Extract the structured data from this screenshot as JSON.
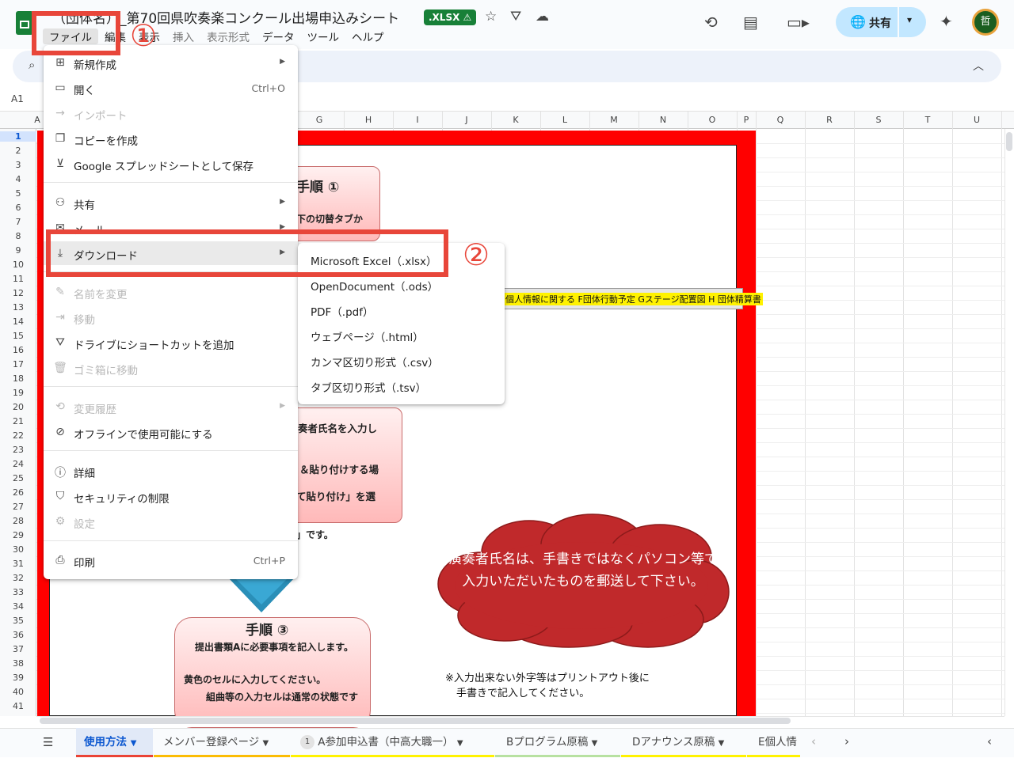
{
  "header": {
    "title": "（団体名）_第70回県吹奏楽コンクール出場申込みシート",
    "file_badge": ".XLSX ⚠",
    "share_label": "共有",
    "avatar_initial": "哲",
    "menus": [
      "ファイル",
      "編集",
      "表示",
      "挿入",
      "表示形式",
      "データ",
      "ツール",
      "ヘルプ"
    ]
  },
  "formula_bar": {
    "cell_ref": "A1"
  },
  "columns": [
    "A",
    "G",
    "H",
    "I",
    "J",
    "K",
    "L",
    "M",
    "N",
    "O",
    "P",
    "Q",
    "R",
    "S",
    "T",
    "U"
  ],
  "rows": [
    "1",
    "2",
    "3",
    "4",
    "5",
    "6",
    "7",
    "8",
    "9",
    "10",
    "11",
    "12",
    "13",
    "14",
    "15",
    "16",
    "17",
    "18",
    "19",
    "20",
    "21",
    "22",
    "23",
    "24",
    "25",
    "26",
    "27",
    "28",
    "29",
    "30",
    "31",
    "32",
    "33",
    "34",
    "35",
    "36",
    "37",
    "38",
    "39",
    "40",
    "41"
  ],
  "file_menu": {
    "items": [
      {
        "icon": "new-icon",
        "label": "新規作成",
        "submenu": true
      },
      {
        "icon": "folder-icon",
        "label": "開く",
        "shortcut": "Ctrl+O"
      },
      {
        "icon": "import-icon",
        "label": "インポート",
        "disabled": true
      },
      {
        "icon": "copy-icon",
        "label": "コピーを作成"
      },
      {
        "icon": "save-icon",
        "label": "Google スプレッドシートとして保存"
      },
      {
        "icon": "share-icon",
        "label": "共有",
        "submenu": true
      },
      {
        "icon": "mail-icon",
        "label": "メール",
        "submenu": true
      },
      {
        "icon": "download-icon",
        "label": "ダウンロード",
        "submenu": true
      },
      {
        "icon": "rename-icon",
        "label": "名前を変更",
        "disabled": true
      },
      {
        "icon": "move-icon",
        "label": "移動",
        "disabled": true
      },
      {
        "icon": "drive-shortcut-icon",
        "label": "ドライブにショートカットを追加"
      },
      {
        "icon": "trash-icon",
        "label": "ゴミ箱に移動",
        "disabled": true
      },
      {
        "icon": "history-icon",
        "label": "変更履歴",
        "submenu": true,
        "disabled": true
      },
      {
        "icon": "offline-icon",
        "label": "オフラインで使用可能にする"
      },
      {
        "icon": "info-icon",
        "label": "詳細"
      },
      {
        "icon": "security-icon",
        "label": "セキュリティの制限"
      },
      {
        "icon": "settings-icon",
        "label": "設定",
        "disabled": true
      },
      {
        "icon": "print-icon",
        "label": "印刷",
        "shortcut": "Ctrl+P"
      }
    ]
  },
  "download_submenu": {
    "items": [
      "Microsoft Excel（.xlsx）",
      "OpenDocument（.ods）",
      "PDF（.pdf）",
      "ウェブページ（.html）",
      "カンマ区切り形式（.csv）",
      "タブ区切り形式（.tsv）"
    ]
  },
  "annotations": {
    "step1": "①",
    "step2": "②"
  },
  "sheet_content": {
    "card1_title": "手順 ①",
    "card1_text": "下の切替タブか",
    "card2_line1": "奏者氏名を入力し",
    "card2_line2": "＆貼り付けする場",
    "card2_line3": "て貼り付け」を選",
    "card2_tail": "」です。",
    "card3_title": "手順 ③",
    "card3_line1": "提出書類Aに必要事項を記入します。",
    "card3_line2": "黄色のセルに入力してください。",
    "card3_line3": "組曲等の入力セルは通常の状態です",
    "cloud_text": "演奏者氏名は、手書きではなくパソコン等で入力いただいたものを郵送して下さい。",
    "note_line1": "※入力出来ない外字等はプリントアウト後に",
    "note_line2": "手書きで記入してください。",
    "tabstrip_text": "個人情報に関する F団体行動予定 Gステージ配置図 H 団体精算書"
  },
  "sheet_tabs": [
    {
      "label": "使用方法",
      "active": true,
      "color": "#ea4335"
    },
    {
      "label": "メンバー登録ページ",
      "color": "#fbbc04"
    },
    {
      "label": "A参加申込書（中高大職一）",
      "badge": "1",
      "color": "#fff200"
    },
    {
      "label": "Bプログラム原稿",
      "color": "#b7e1a1"
    },
    {
      "label": "Dアナウンス原稿",
      "color": "#fff200"
    },
    {
      "label": "E個人情",
      "color": "#fff200"
    }
  ]
}
